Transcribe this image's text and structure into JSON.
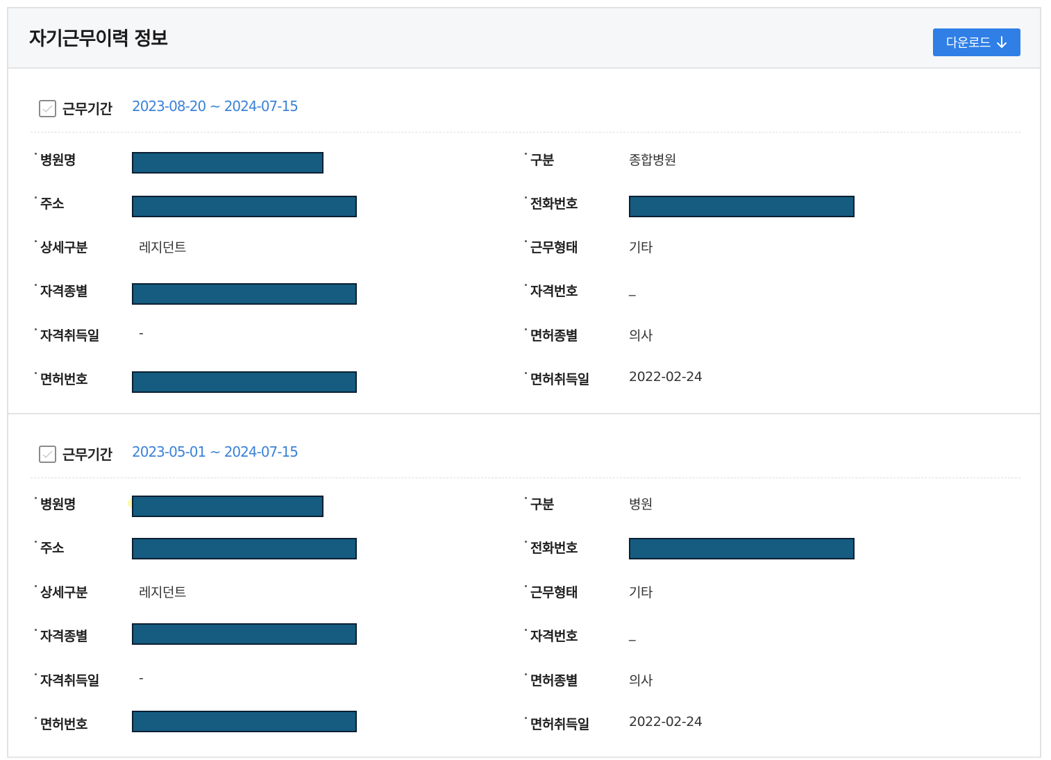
{
  "header": {
    "title": "자기근무이력 정보",
    "download_label": "다운로드",
    "download_icon": "arrow-down-icon",
    "accent_color": "#2f7fe6"
  },
  "redaction_color": "#155c80",
  "records": [
    {
      "period_label": "근무기간",
      "period_value": "2023-08-20 ~ 2024-07-15",
      "left": {
        "hospital_name": {
          "label": "병원명",
          "value": "[redacted]"
        },
        "address": {
          "label": "주소",
          "value": "[redacted]"
        },
        "detail_category": {
          "label": "상세구분",
          "value": "레지던트"
        },
        "qualification_type": {
          "label": "자격종별",
          "value": "[redacted]"
        },
        "qualification_date": {
          "label": "자격취득일",
          "value": "-"
        },
        "license_number": {
          "label": "면허번호",
          "value": "[redacted]"
        }
      },
      "right": {
        "category": {
          "label": "구분",
          "value": "종합병원"
        },
        "phone": {
          "label": "전화번호",
          "value": "[redacted]"
        },
        "work_type": {
          "label": "근무형태",
          "value": "기타"
        },
        "qualification_number": {
          "label": "자격번호",
          "value": "_"
        },
        "license_type": {
          "label": "면허종별",
          "value": "의사"
        },
        "license_date": {
          "label": "면허취득일",
          "value": "2022-02-24"
        }
      }
    },
    {
      "period_label": "근무기간",
      "period_value": "2023-05-01 ~ 2024-07-15",
      "left": {
        "hospital_name": {
          "label": "병원명",
          "value": "[redacted]"
        },
        "address": {
          "label": "주소",
          "value": "[redacted]"
        },
        "detail_category": {
          "label": "상세구분",
          "value": "레지던트"
        },
        "qualification_type": {
          "label": "자격종별",
          "value": "[redacted]"
        },
        "qualification_date": {
          "label": "자격취득일",
          "value": "-"
        },
        "license_number": {
          "label": "면허번호",
          "value": "[redacted]"
        }
      },
      "right": {
        "category": {
          "label": "구분",
          "value": "병원"
        },
        "phone": {
          "label": "전화번호",
          "value": "[redacted]"
        },
        "work_type": {
          "label": "근무형태",
          "value": "기타"
        },
        "qualification_number": {
          "label": "자격번호",
          "value": "_"
        },
        "license_type": {
          "label": "면허종별",
          "value": "의사"
        },
        "license_date": {
          "label": "면허취득일",
          "value": "2022-02-24"
        }
      }
    }
  ]
}
